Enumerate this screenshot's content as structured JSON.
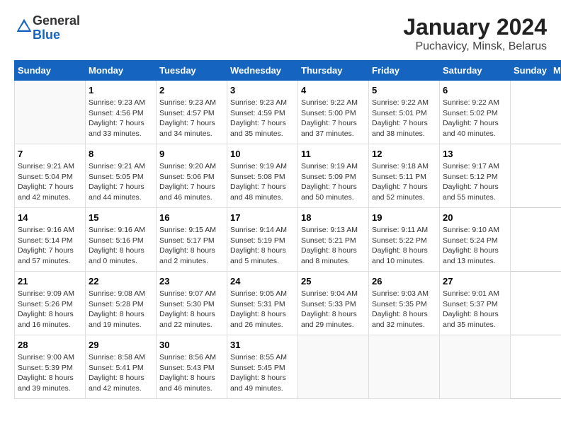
{
  "logo": {
    "general": "General",
    "blue": "Blue"
  },
  "title": "January 2024",
  "location": "Puchavicy, Minsk, Belarus",
  "days_of_week": [
    "Sunday",
    "Monday",
    "Tuesday",
    "Wednesday",
    "Thursday",
    "Friday",
    "Saturday"
  ],
  "weeks": [
    [
      {
        "day": "",
        "info": ""
      },
      {
        "day": "1",
        "info": "Sunrise: 9:23 AM\nSunset: 4:56 PM\nDaylight: 7 hours\nand 33 minutes."
      },
      {
        "day": "2",
        "info": "Sunrise: 9:23 AM\nSunset: 4:57 PM\nDaylight: 7 hours\nand 34 minutes."
      },
      {
        "day": "3",
        "info": "Sunrise: 9:23 AM\nSunset: 4:59 PM\nDaylight: 7 hours\nand 35 minutes."
      },
      {
        "day": "4",
        "info": "Sunrise: 9:22 AM\nSunset: 5:00 PM\nDaylight: 7 hours\nand 37 minutes."
      },
      {
        "day": "5",
        "info": "Sunrise: 9:22 AM\nSunset: 5:01 PM\nDaylight: 7 hours\nand 38 minutes."
      },
      {
        "day": "6",
        "info": "Sunrise: 9:22 AM\nSunset: 5:02 PM\nDaylight: 7 hours\nand 40 minutes."
      }
    ],
    [
      {
        "day": "7",
        "info": "Sunrise: 9:21 AM\nSunset: 5:04 PM\nDaylight: 7 hours\nand 42 minutes."
      },
      {
        "day": "8",
        "info": "Sunrise: 9:21 AM\nSunset: 5:05 PM\nDaylight: 7 hours\nand 44 minutes."
      },
      {
        "day": "9",
        "info": "Sunrise: 9:20 AM\nSunset: 5:06 PM\nDaylight: 7 hours\nand 46 minutes."
      },
      {
        "day": "10",
        "info": "Sunrise: 9:19 AM\nSunset: 5:08 PM\nDaylight: 7 hours\nand 48 minutes."
      },
      {
        "day": "11",
        "info": "Sunrise: 9:19 AM\nSunset: 5:09 PM\nDaylight: 7 hours\nand 50 minutes."
      },
      {
        "day": "12",
        "info": "Sunrise: 9:18 AM\nSunset: 5:11 PM\nDaylight: 7 hours\nand 52 minutes."
      },
      {
        "day": "13",
        "info": "Sunrise: 9:17 AM\nSunset: 5:12 PM\nDaylight: 7 hours\nand 55 minutes."
      }
    ],
    [
      {
        "day": "14",
        "info": "Sunrise: 9:16 AM\nSunset: 5:14 PM\nDaylight: 7 hours\nand 57 minutes."
      },
      {
        "day": "15",
        "info": "Sunrise: 9:16 AM\nSunset: 5:16 PM\nDaylight: 8 hours\nand 0 minutes."
      },
      {
        "day": "16",
        "info": "Sunrise: 9:15 AM\nSunset: 5:17 PM\nDaylight: 8 hours\nand 2 minutes."
      },
      {
        "day": "17",
        "info": "Sunrise: 9:14 AM\nSunset: 5:19 PM\nDaylight: 8 hours\nand 5 minutes."
      },
      {
        "day": "18",
        "info": "Sunrise: 9:13 AM\nSunset: 5:21 PM\nDaylight: 8 hours\nand 8 minutes."
      },
      {
        "day": "19",
        "info": "Sunrise: 9:11 AM\nSunset: 5:22 PM\nDaylight: 8 hours\nand 10 minutes."
      },
      {
        "day": "20",
        "info": "Sunrise: 9:10 AM\nSunset: 5:24 PM\nDaylight: 8 hours\nand 13 minutes."
      }
    ],
    [
      {
        "day": "21",
        "info": "Sunrise: 9:09 AM\nSunset: 5:26 PM\nDaylight: 8 hours\nand 16 minutes."
      },
      {
        "day": "22",
        "info": "Sunrise: 9:08 AM\nSunset: 5:28 PM\nDaylight: 8 hours\nand 19 minutes."
      },
      {
        "day": "23",
        "info": "Sunrise: 9:07 AM\nSunset: 5:30 PM\nDaylight: 8 hours\nand 22 minutes."
      },
      {
        "day": "24",
        "info": "Sunrise: 9:05 AM\nSunset: 5:31 PM\nDaylight: 8 hours\nand 26 minutes."
      },
      {
        "day": "25",
        "info": "Sunrise: 9:04 AM\nSunset: 5:33 PM\nDaylight: 8 hours\nand 29 minutes."
      },
      {
        "day": "26",
        "info": "Sunrise: 9:03 AM\nSunset: 5:35 PM\nDaylight: 8 hours\nand 32 minutes."
      },
      {
        "day": "27",
        "info": "Sunrise: 9:01 AM\nSunset: 5:37 PM\nDaylight: 8 hours\nand 35 minutes."
      }
    ],
    [
      {
        "day": "28",
        "info": "Sunrise: 9:00 AM\nSunset: 5:39 PM\nDaylight: 8 hours\nand 39 minutes."
      },
      {
        "day": "29",
        "info": "Sunrise: 8:58 AM\nSunset: 5:41 PM\nDaylight: 8 hours\nand 42 minutes."
      },
      {
        "day": "30",
        "info": "Sunrise: 8:56 AM\nSunset: 5:43 PM\nDaylight: 8 hours\nand 46 minutes."
      },
      {
        "day": "31",
        "info": "Sunrise: 8:55 AM\nSunset: 5:45 PM\nDaylight: 8 hours\nand 49 minutes."
      },
      {
        "day": "",
        "info": ""
      },
      {
        "day": "",
        "info": ""
      },
      {
        "day": "",
        "info": ""
      }
    ]
  ]
}
